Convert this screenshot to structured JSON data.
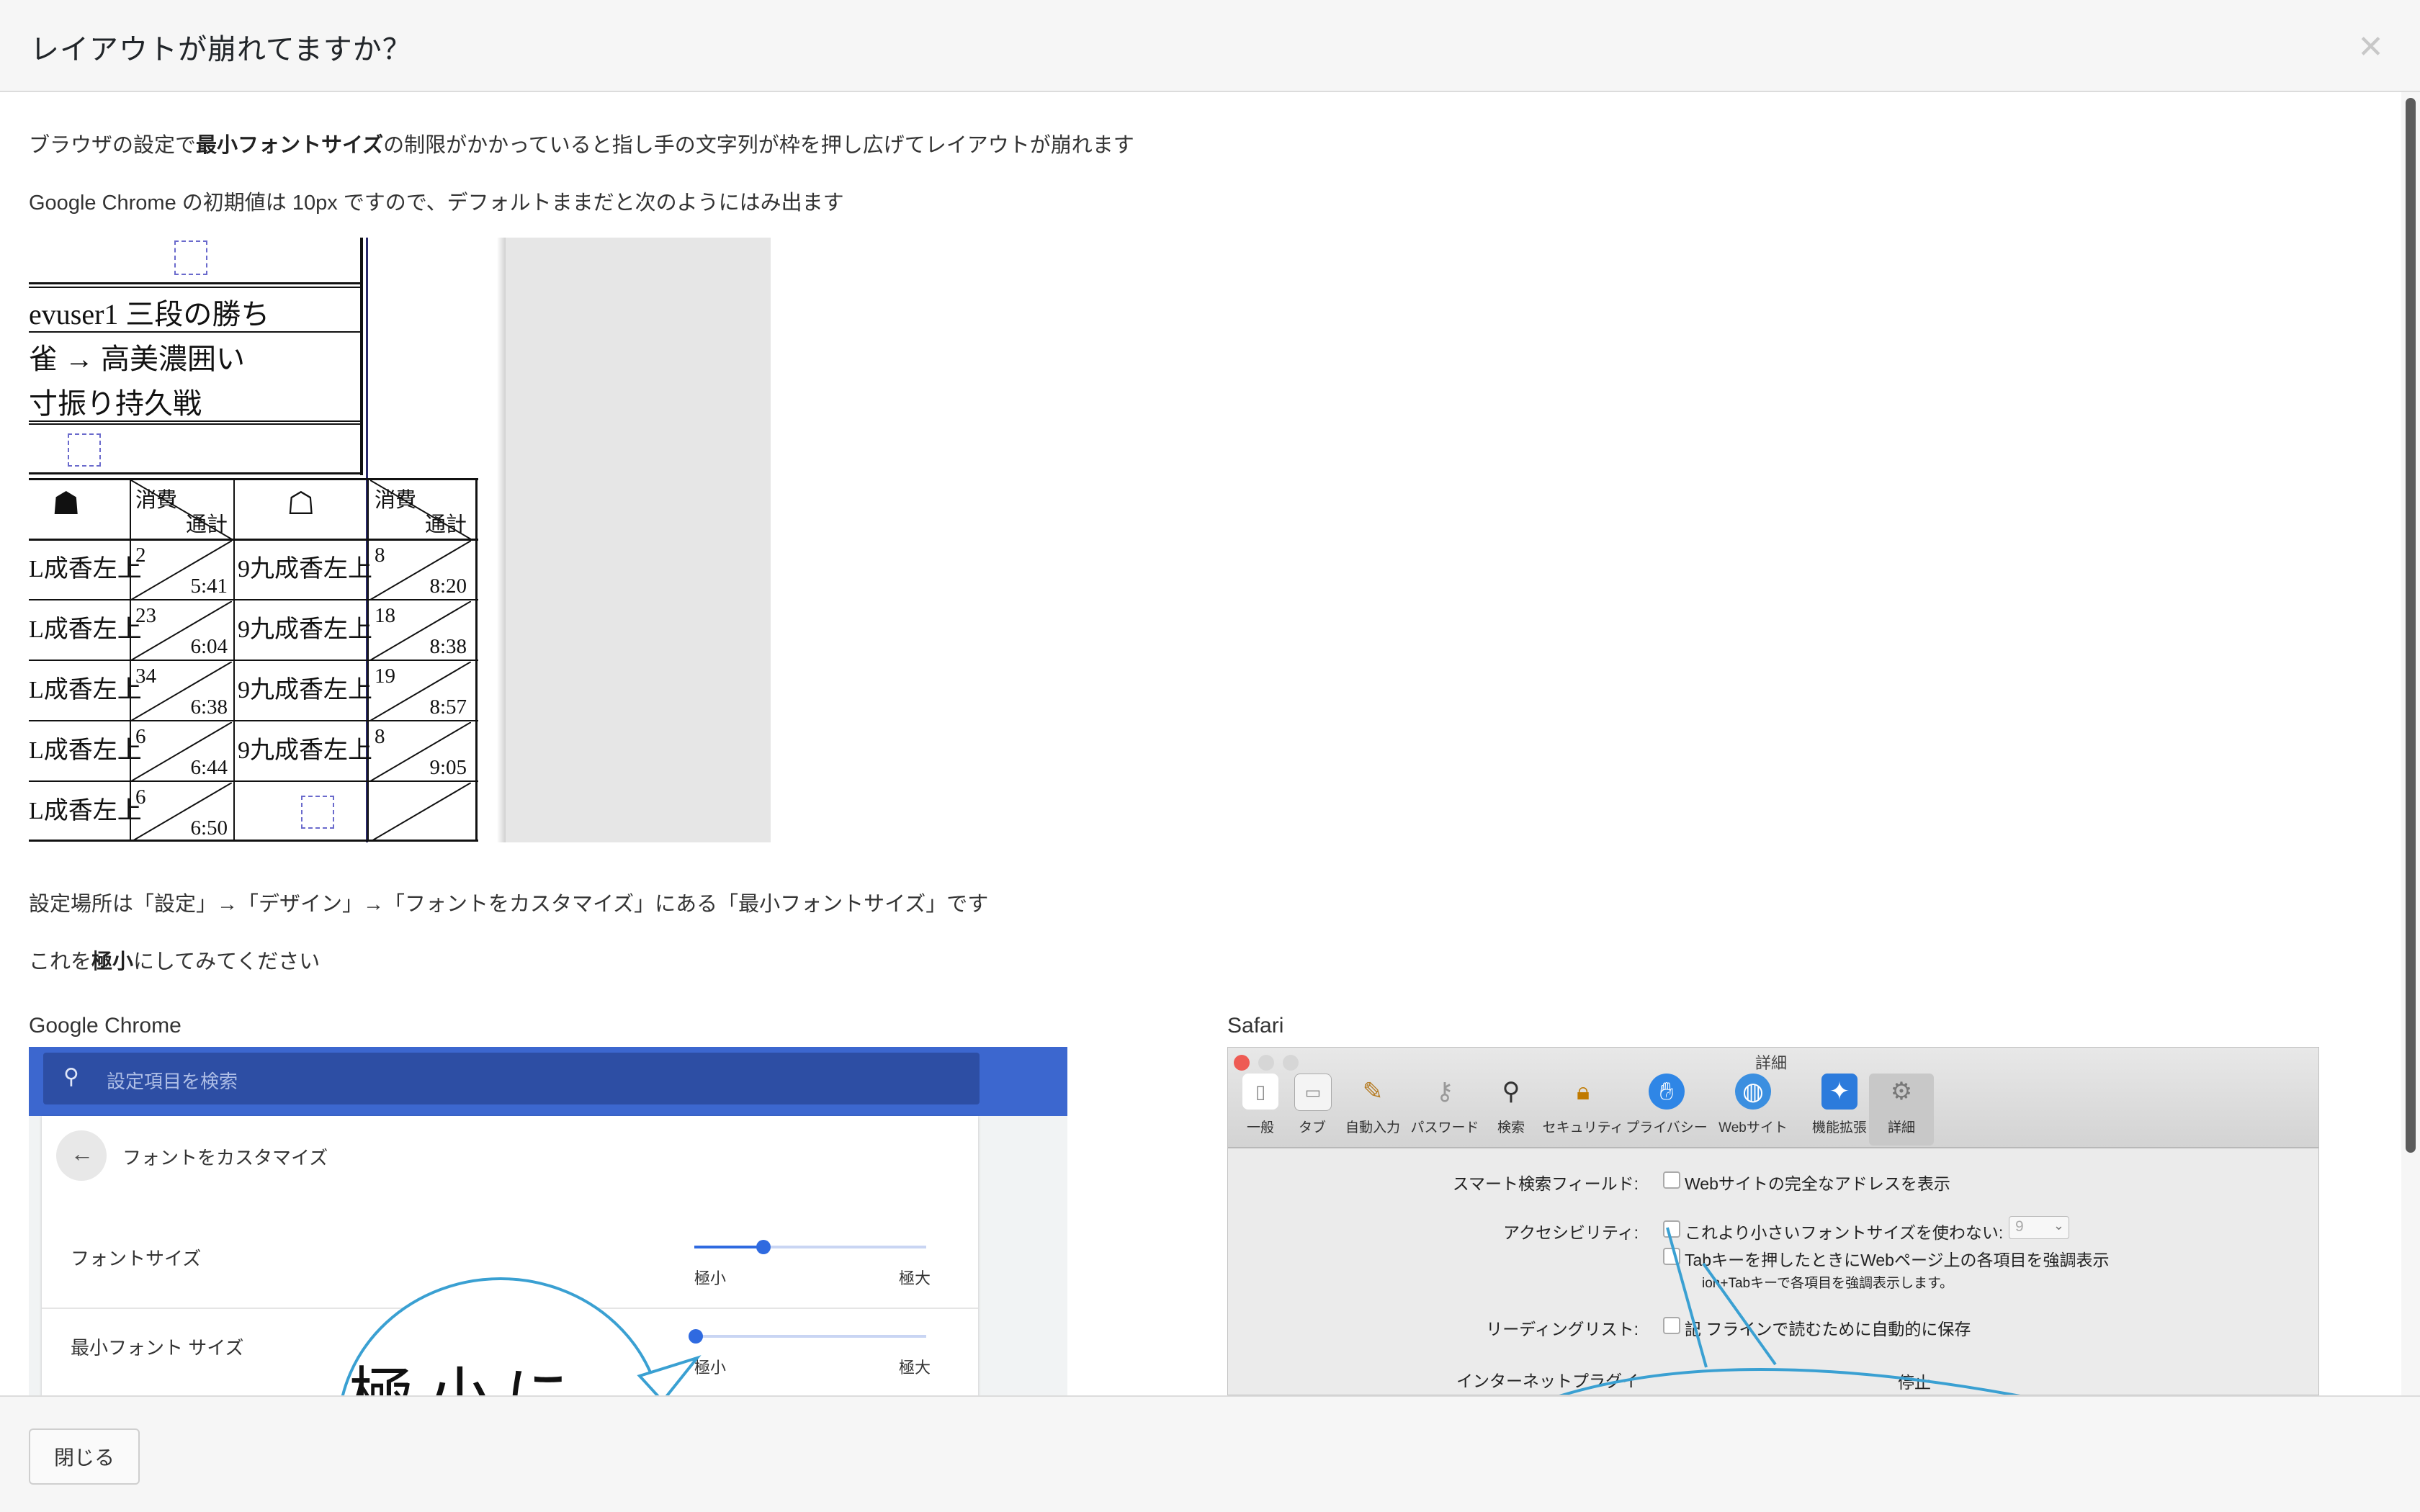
{
  "modal": {
    "title": "レイアウトが崩れてますか？",
    "close_icon": "close-icon",
    "close_button": "閉じる"
  },
  "body": {
    "p1_before": "ブラウザの設定で",
    "p1_bold": "最小フォントサイズ",
    "p1_after": "の制限がかかっていると指し手の文字列が枠を押し広げてレイアウトが崩れます",
    "p2": "Google Chrome の初期値は 10px ですので、デフォルトままだと次のようにはみ出ます",
    "p3": "設定場所は「設定」→「デザイン」→「フォントをカスタマイズ」にある「最小フォントサイズ」です",
    "p4_before": "これを",
    "p4_bold": "極小",
    "p4_after": "にしてみてください"
  },
  "kifu": {
    "header_lines": [
      "evuser1 三段の勝ち",
      "雀 → 高美濃囲い",
      "寸振り持久戦"
    ],
    "sente_mark": "☗",
    "gote_mark": "☖",
    "col_time_top": "消費",
    "col_time_bottom": "通計",
    "rows": [
      {
        "move_l": "L成香左上",
        "used_l": "2",
        "total_l": "5:41",
        "move_r": "9九成香左上",
        "used_r": "8",
        "total_r": "8:20"
      },
      {
        "move_l": "L成香左上",
        "used_l": "23",
        "total_l": "6:04",
        "move_r": "9九成香左上",
        "used_r": "18",
        "total_r": "8:38"
      },
      {
        "move_l": "L成香左上",
        "used_l": "34",
        "total_l": "6:38",
        "move_r": "9九成香左上",
        "used_r": "19",
        "total_r": "8:57"
      },
      {
        "move_l": "L成香左上",
        "used_l": "6",
        "total_l": "6:44",
        "move_r": "9九成香左上",
        "used_r": "8",
        "total_r": "9:05"
      },
      {
        "move_l": "L成香左上",
        "used_l": "6",
        "total_l": "6:50",
        "move_r": "",
        "used_r": "",
        "total_r": ""
      }
    ]
  },
  "chrome": {
    "label": "Google Chrome",
    "search_placeholder": "設定項目を検索",
    "back_label": "フォントをカスタマイズ",
    "font_size_label": "フォントサイズ",
    "min_font_label": "最小フォント サイズ",
    "slider_min": "極小",
    "slider_max": "極大",
    "font_size_level": 0.3,
    "min_font_level": 0.0,
    "callout": "極小に"
  },
  "safari": {
    "label": "Safari",
    "window_title": "詳細",
    "tools": [
      "一般",
      "タブ",
      "自動入力",
      "パスワード",
      "検索",
      "セキュリティ",
      "プライバシー",
      "Webサイト",
      "機能拡張",
      "詳細"
    ],
    "smart_search_label": "スマート検索フィールド:",
    "smart_search_option": "Webサイトの完全なアドレスを表示",
    "accessibility_label": "アクセシビリティ:",
    "min_font_option": "これより小さいフォントサイズを使わない:",
    "min_font_value": "9",
    "tab_option": "Tabキーを押したときにWebページ上の各項目を強調表示",
    "tab_note": "ion+Tabキーで各項目を強調表示します。",
    "reading_label": "リーディングリスト:",
    "reading_option": "記  フラインで読むために自動的に保存",
    "internet_label": "インターネットプラグイ",
    "internet_option": "停止"
  }
}
